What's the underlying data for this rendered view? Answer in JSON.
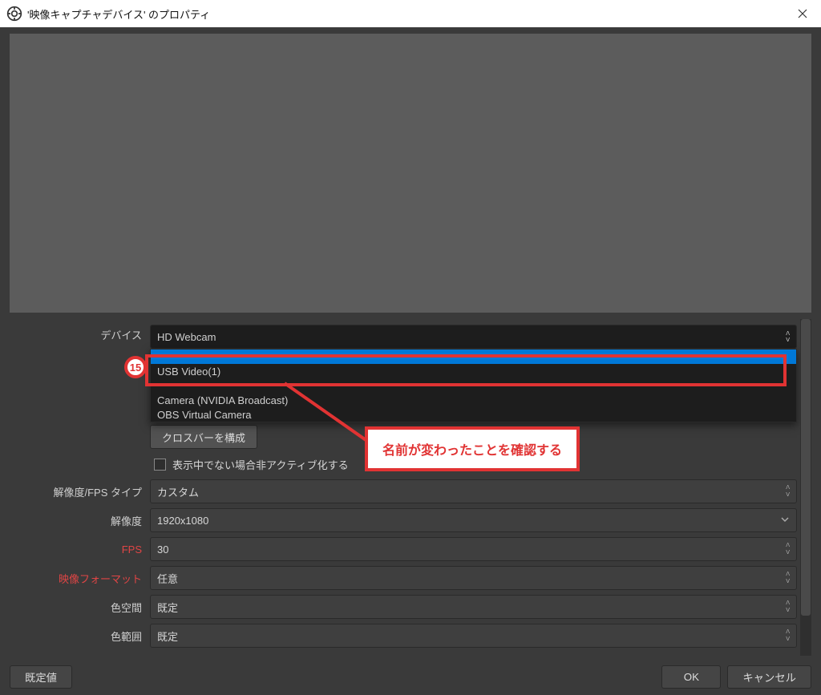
{
  "title": "'映像キャプチャデバイス' のプロパティ",
  "device_label": "デバイス",
  "device_selected": "HD Webcam",
  "device_options": [
    "",
    "USB Video(1)",
    "",
    "Camera (NVIDIA Broadcast)",
    "OBS Virtual Camera"
  ],
  "crossbar_btn": "クロスバーを構成",
  "deactivate_label": "表示中でない場合非アクティブ化する",
  "rows": {
    "res_fps_type": {
      "label": "解像度/FPS タイプ",
      "value": "カスタム"
    },
    "resolution": {
      "label": "解像度",
      "value": "1920x1080"
    },
    "fps": {
      "label": "FPS",
      "value": "30"
    },
    "video_format": {
      "label": "映像フォーマット",
      "value": "任意"
    },
    "colorspace": {
      "label": "色空間",
      "value": "既定"
    },
    "colorrange": {
      "label": "色範囲",
      "value": "既定"
    }
  },
  "footer": {
    "defaults": "既定値",
    "ok": "OK",
    "cancel": "キャンセル"
  },
  "callout": {
    "badge": "15",
    "note": "名前が変わったことを確認する"
  }
}
